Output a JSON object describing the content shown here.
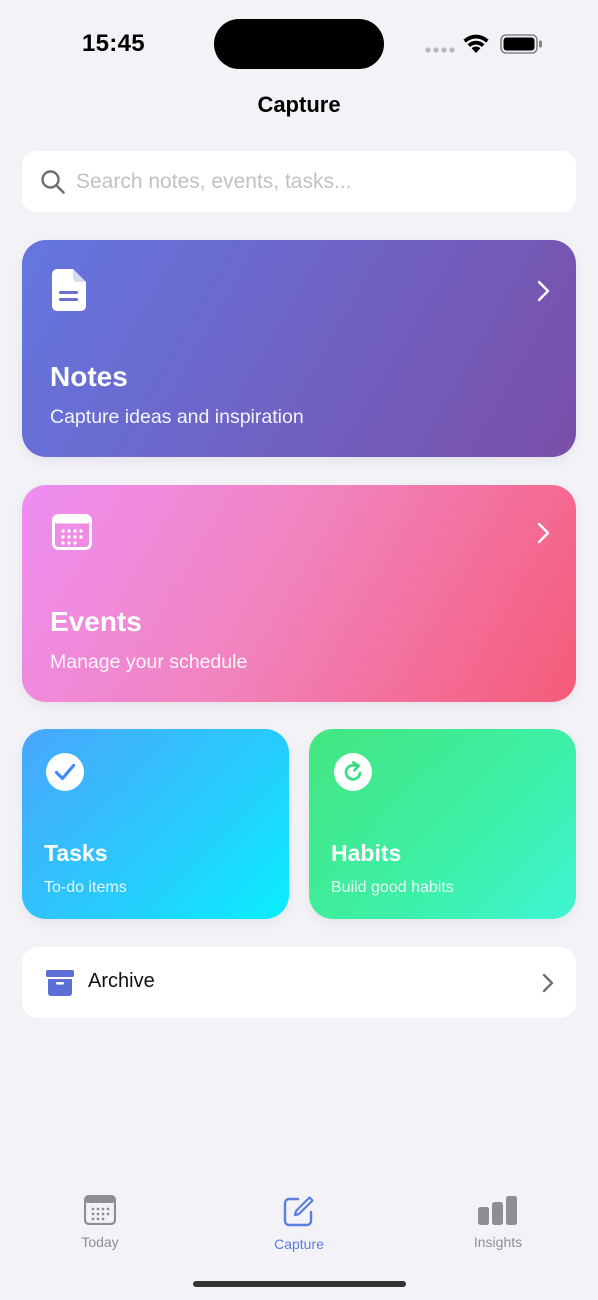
{
  "status_bar": {
    "time": "15:45"
  },
  "header": {
    "title": "Capture"
  },
  "search": {
    "placeholder": "Search notes, events, tasks...",
    "value": ""
  },
  "cards": {
    "notes": {
      "title": "Notes",
      "subtitle": "Capture ideas and inspiration",
      "icon": "document-icon"
    },
    "events": {
      "title": "Events",
      "subtitle": "Manage your schedule",
      "icon": "calendar-icon"
    },
    "tasks": {
      "title": "Tasks",
      "subtitle": "To-do items",
      "icon": "checkmark-circle-icon"
    },
    "habits": {
      "title": "Habits",
      "subtitle": "Build good habits",
      "icon": "refresh-circle-icon"
    }
  },
  "archive": {
    "label": "Archive",
    "icon": "archive-box-icon"
  },
  "tab_bar": {
    "tabs": [
      {
        "label": "Today",
        "icon": "calendar-icon"
      },
      {
        "label": "Capture",
        "icon": "pencil-square-icon"
      },
      {
        "label": "Insights",
        "icon": "bar-chart-icon"
      }
    ],
    "active": "Capture"
  },
  "colors": {
    "background": "#f2f2f7",
    "accent": "#5b7ee0",
    "archive_icon": "#5c6fd6",
    "tab_inactive": "#8e8e93"
  }
}
